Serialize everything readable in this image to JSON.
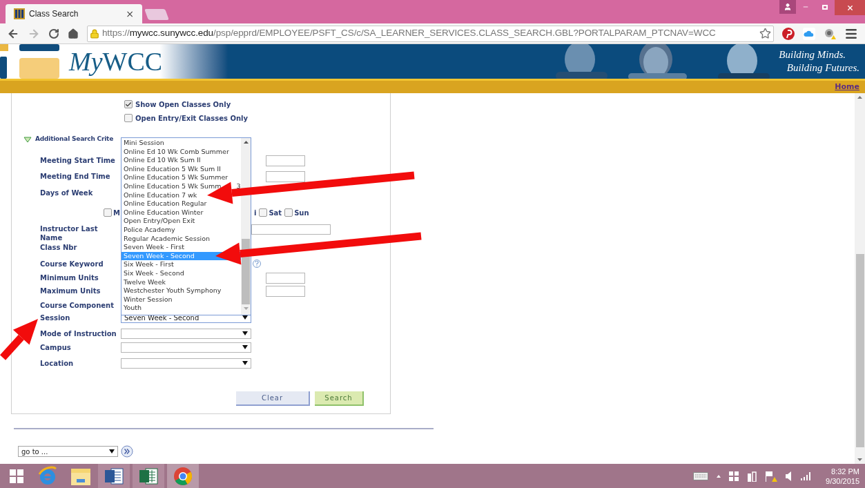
{
  "browser": {
    "tab": {
      "title": "Class Search",
      "close": "×"
    },
    "url": {
      "scheme": "https://",
      "host": "mywcc.sunywcc.edu",
      "path": "/psp/epprd/EMPLOYEE/PSFT_CS/c/SA_LEARNER_SERVICES.CLASS_SEARCH.GBL?PORTALPARAM_PTCNAV=WCC"
    }
  },
  "header": {
    "logo": {
      "italic": "My",
      "plain": "WCC"
    },
    "tagline": [
      "Building Minds.",
      "Building Futures."
    ],
    "home_link": "Home"
  },
  "form": {
    "options": [
      {
        "label": "Show Open Classes Only",
        "checked": true
      },
      {
        "label": "Open Entry/Exit Classes Only",
        "checked": false
      }
    ],
    "section": {
      "title": "Additional Search Crite",
      "expanded": true
    },
    "fields": [
      {
        "kind": "time",
        "label": "Meeting Start Time"
      },
      {
        "kind": "time",
        "label": "Meeting End Time"
      },
      {
        "kind": "label",
        "label": "Days of Week"
      },
      {
        "kind": "days",
        "days": [
          {
            "label": "M",
            "checked": false
          },
          {
            "label": "i"
          },
          {
            "label": "Sat",
            "checked": false
          },
          {
            "label": "Sun",
            "checked": false
          }
        ]
      },
      {
        "kind": "text",
        "label": "Instructor Last Name"
      },
      {
        "kind": "label",
        "label": "Class Nbr"
      },
      {
        "kind": "keyword",
        "label": "Course Keyword"
      },
      {
        "kind": "units",
        "label": "Minimum Units"
      },
      {
        "kind": "units",
        "label": "Maximum Units"
      },
      {
        "kind": "label",
        "label": "Course Component"
      },
      {
        "kind": "select",
        "label": "Session",
        "value": "Seven Week - Second",
        "focused": true
      },
      {
        "kind": "select",
        "label": "Mode of Instruction",
        "focused": false
      },
      {
        "kind": "select",
        "label": "Campus",
        "focused": false
      },
      {
        "kind": "select",
        "label": "Location",
        "focused": false
      }
    ],
    "session_list": [
      {
        "label": "Mini Session",
        "selected": false
      },
      {
        "label": "Online Ed 10 Wk Comb Summer",
        "selected": false
      },
      {
        "label": "Online Ed 10 Wk Sum II",
        "selected": false
      },
      {
        "label": "Online Education 5 Wk Sum II",
        "selected": false
      },
      {
        "label": "Online Education 5 Wk Summer",
        "selected": false
      },
      {
        "label": "Online Education 5 Wk Summ",
        "tail": "3",
        "selected": false
      },
      {
        "label": "Online Education 7 wk",
        "selected": false
      },
      {
        "label": "Online Education Regular",
        "selected": false
      },
      {
        "label": "Online Education Winter",
        "selected": false
      },
      {
        "label": "Open Entry/Open Exit",
        "selected": false
      },
      {
        "label": "Police Academy",
        "selected": false
      },
      {
        "label": "Regular Academic Session",
        "selected": false
      },
      {
        "label": "Seven Week - First",
        "selected": false
      },
      {
        "label": "Seven Week - Second",
        "selected": true
      },
      {
        "label": "Six Week - First",
        "selected": false
      },
      {
        "label": "Six Week - Second",
        "selected": false
      },
      {
        "label": "Twelve Week",
        "selected": false
      },
      {
        "label": "Westchester Youth Symphony",
        "selected": false
      },
      {
        "label": "Winter Session",
        "selected": false
      },
      {
        "label": "Youth",
        "selected": false
      }
    ],
    "buttons": [
      {
        "label": "Clear",
        "kind": "clear"
      },
      {
        "label": "Search",
        "kind": "search"
      }
    ]
  },
  "footer": {
    "goto": "go to ..."
  },
  "taskbar": {
    "time": "8:32 PM",
    "date": "9/30/2015"
  }
}
